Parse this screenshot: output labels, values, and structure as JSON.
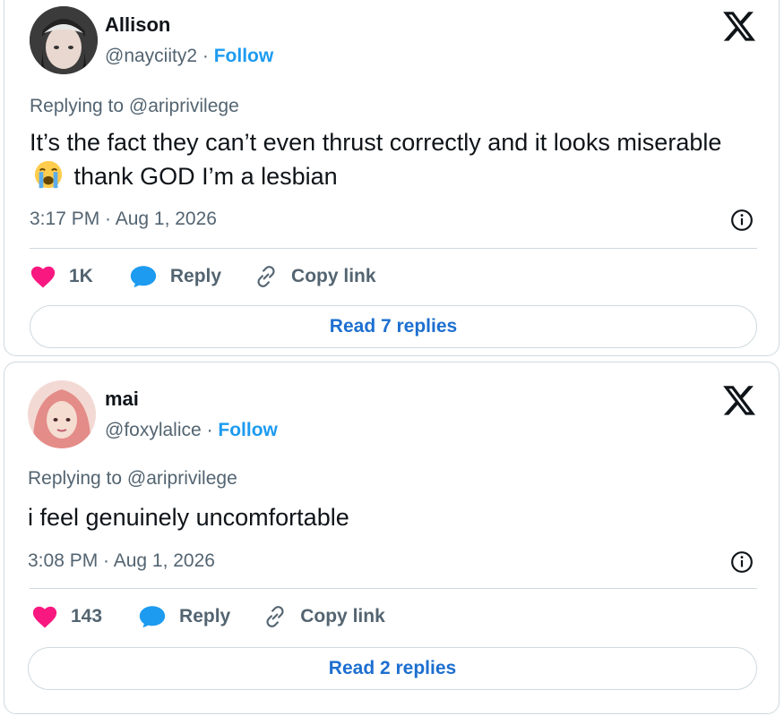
{
  "tweets": [
    {
      "name": "Allison",
      "handle": "@nayciity2",
      "separator": "·",
      "follow": "Follow",
      "replying_to": "Replying to @ariprivilege",
      "text_before_emoji": "It’s the fact they can’t even thrust correctly and it looks miserable",
      "emoji": "loudly-crying-face-emoji",
      "text_after_emoji": "thank GOD I’m a lesbian",
      "timestamp": "3:17 PM · Aug 1, 2026",
      "likes": "1K",
      "reply_label": "Reply",
      "copy_link_label": "Copy link",
      "read_replies": "Read 7 replies"
    },
    {
      "name": "mai",
      "handle": "@foxylalice",
      "separator": "·",
      "follow": "Follow",
      "replying_to": "Replying to @ariprivilege",
      "text": "i feel genuinely uncomfortable",
      "timestamp": "3:08 PM · Aug 1, 2026",
      "likes": "143",
      "reply_label": "Reply",
      "copy_link_label": "Copy link",
      "read_replies": "Read 2 replies"
    }
  ],
  "colors": {
    "like": "#f91880",
    "reply": "#1d9bf0",
    "link": "#1d6fd0",
    "muted": "#536471",
    "border": "#cfd9de"
  },
  "icons": [
    "x-logo-icon",
    "info-icon",
    "heart-icon",
    "reply-bubble-icon",
    "link-icon"
  ]
}
